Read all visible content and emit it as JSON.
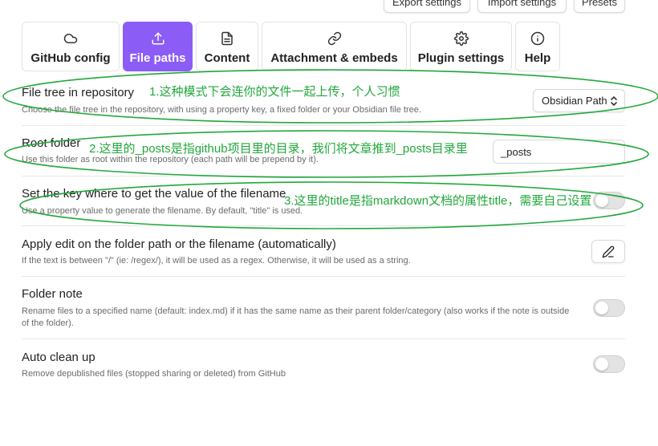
{
  "top_buttons": {
    "export": "Export settings",
    "import": "Import settings",
    "presets": "Presets"
  },
  "tabs": [
    {
      "label": "GitHub config",
      "icon": "cloud-icon",
      "active": false
    },
    {
      "label": "File paths",
      "icon": "upload-icon",
      "active": true
    },
    {
      "label": "Content",
      "icon": "file-text-icon",
      "active": false
    },
    {
      "label": "Attachment & embeds",
      "icon": "link-icon",
      "active": false
    },
    {
      "label": "Plugin settings",
      "icon": "gear-icon",
      "active": false
    },
    {
      "label": "Help",
      "icon": "info-icon",
      "active": false
    }
  ],
  "settings": {
    "file_tree": {
      "name": "File tree in repository",
      "desc": "Choose the file tree in the repository, with using a property key, a fixed folder or your Obsidian file tree.",
      "value": "Obsidian Path"
    },
    "root_folder": {
      "name": "Root folder",
      "desc": "Use this folder as root within the repository (each path will be prepend by it).",
      "value": "_posts"
    },
    "filename_key": {
      "name": "Set the key where to get the value of the filename",
      "desc": "Use a property value to generate the filename. By default, \"title\" is used.",
      "enabled": false
    },
    "apply_edit": {
      "name": "Apply edit on the folder path or the filename (automatically)",
      "desc": "If the text is between \"/\" (ie: /regex/), it will be used as a regex. Otherwise, it will be used as a string."
    },
    "folder_note": {
      "name": "Folder note",
      "desc": "Rename files to a specified name (default: index.md) if it has the same name as their parent folder/category (also works if the note is outside of the folder).",
      "enabled": false
    },
    "auto_clean": {
      "name": "Auto clean up",
      "desc": "Remove depublished files (stopped sharing or deleted) from GitHub",
      "enabled": false
    }
  },
  "annotations": {
    "note1": "1.这种模式下会连你的文件一起上传，个人习惯",
    "note2": "2.这里的_posts是指github项目里的目录，我们将文章推到_posts目录里",
    "note3": "3.这里的title是指markdown文档的属性title，需要自己设置",
    "color": "#22a83c"
  },
  "colors": {
    "accent": "#8b5cf6",
    "annotation": "#22a83c"
  }
}
